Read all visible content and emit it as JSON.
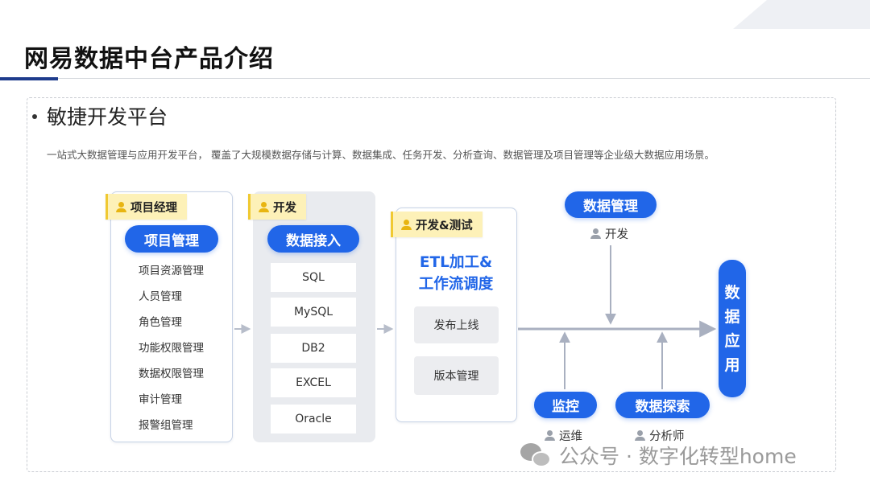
{
  "header": {
    "title": "网易数据中台产品介绍"
  },
  "section": {
    "title": "敏捷开发平台",
    "description": "一站式大数据管理与应用开发平台， 覆盖了大规模数据存储与计算、数据集成、任务开发、分析查询、数据管理及项目管理等企业级大数据应用场景。"
  },
  "diagram": {
    "project": {
      "tag": "项目经理",
      "title": "项目管理",
      "items": [
        "项目资源管理",
        "人员管理",
        "角色管理",
        "功能权限管理",
        "数据权限管理",
        "审计管理",
        "报警组管理"
      ]
    },
    "ingest": {
      "tag": "开发",
      "title": "数据接入",
      "sources": [
        "SQL",
        "MySQL",
        "DB2",
        "EXCEL",
        "Oracle"
      ]
    },
    "etl": {
      "tag": "开发&测试",
      "title_line1": "ETL加工&",
      "title_line2": "工作流调度",
      "items": [
        "发布上线",
        "版本管理"
      ]
    },
    "data_management": {
      "title": "数据管理",
      "role": "开发"
    },
    "monitoring": {
      "title": "监控",
      "role": "运维"
    },
    "data_exploration": {
      "title": "数据探索",
      "role": "分析师"
    },
    "data_application": {
      "chars": [
        "数",
        "据",
        "应",
        "用"
      ]
    }
  },
  "watermark": {
    "text": "公众号 · 数字化转型home"
  },
  "colors": {
    "primary_blue": "#2166e8",
    "tag_yellow": "#fdf1b8",
    "title_accent": "#1e3c8c"
  }
}
